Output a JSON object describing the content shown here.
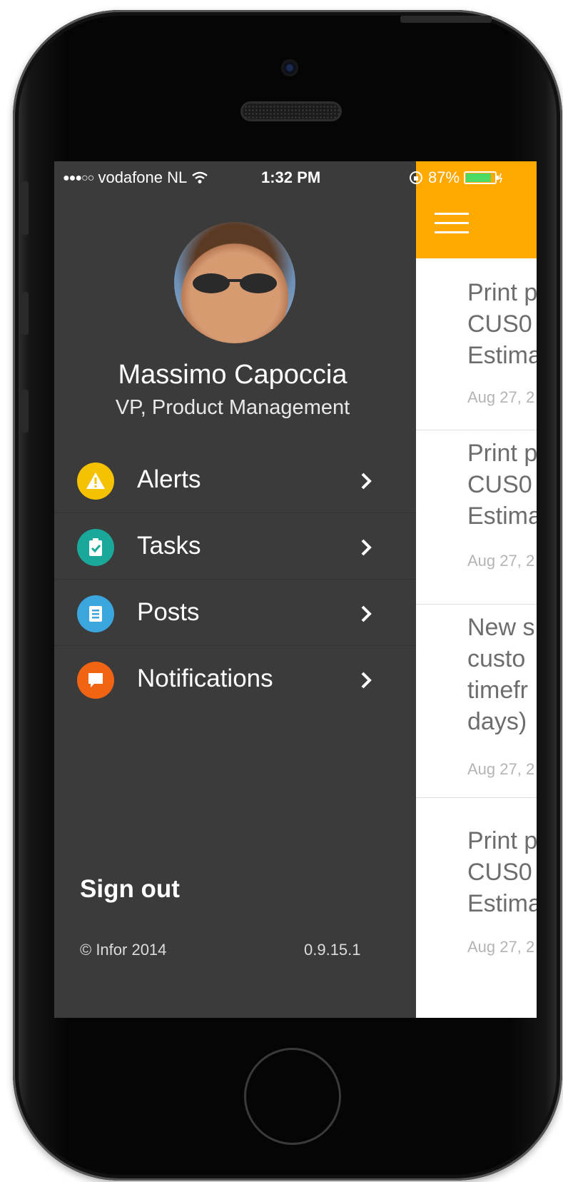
{
  "status_bar": {
    "signal": "●●●○○",
    "carrier": "vodafone NL",
    "time": "1:32 PM",
    "battery_percent": "87%",
    "battery_level": 0.87
  },
  "profile": {
    "name": "Massimo Capoccia",
    "title": "VP, Product Management"
  },
  "menu": {
    "items": [
      {
        "label": "Alerts",
        "icon": "warning-icon",
        "color": "#f5c200"
      },
      {
        "label": "Tasks",
        "icon": "clipboard-check-icon",
        "color": "#1aa89a"
      },
      {
        "label": "Posts",
        "icon": "document-icon",
        "color": "#3aa6dd"
      },
      {
        "label": "Notifications",
        "icon": "chat-bubble-icon",
        "color": "#f06414"
      }
    ]
  },
  "footer": {
    "sign_out": "Sign out",
    "copyright": "© Infor 2014",
    "version": "0.9.15.1"
  },
  "header": {
    "accent_color": "#ffa800"
  },
  "feed": {
    "items": [
      {
        "lines": [
          "Print p",
          "CUS0",
          "Estima"
        ],
        "date": "Aug 27, 2"
      },
      {
        "lines": [
          "Print p",
          "CUS0",
          "Estima"
        ],
        "date": "Aug 27, 2"
      },
      {
        "lines": [
          "New s",
          "custo",
          "timefr",
          "days)"
        ],
        "date": "Aug 27, 2"
      },
      {
        "lines": [
          "Print p",
          "CUS0",
          "Estima"
        ],
        "date": "Aug 27, 2"
      }
    ]
  }
}
